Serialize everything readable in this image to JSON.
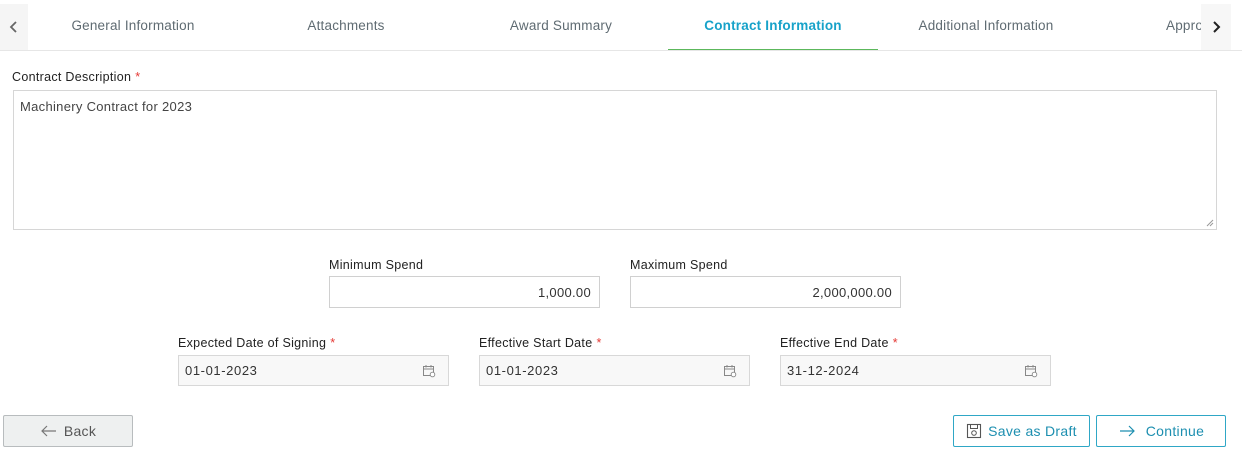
{
  "tabs": [
    {
      "label": "General Information",
      "active": false
    },
    {
      "label": "Attachments",
      "active": false
    },
    {
      "label": "Award Summary",
      "active": false
    },
    {
      "label": "Contract Information",
      "active": true
    },
    {
      "label": "Additional Information",
      "active": false
    },
    {
      "label": "Appro",
      "active": false
    }
  ],
  "icons": {
    "prev": "chevron-left-icon",
    "next": "chevron-right-icon",
    "calendar": "calendar-icon",
    "back": "arrow-left-icon",
    "draft": "save-draft-icon",
    "continue": "arrow-right-icon"
  },
  "colors": {
    "accent": "#17a2c9",
    "tab_underline": "#5cb85c",
    "required": "#e53935",
    "button_border": "#2fa7c6"
  },
  "form": {
    "contract_description": {
      "label": "Contract Description",
      "required": "*",
      "value": "Machinery Contract for 2023"
    },
    "minimum_spend": {
      "label": "Minimum Spend",
      "value": "1,000.00"
    },
    "maximum_spend": {
      "label": "Maximum Spend",
      "value": "2,000,000.00"
    },
    "expected_signing": {
      "label": "Expected Date of Signing",
      "required": "*",
      "value": "01-01-2023"
    },
    "effective_start": {
      "label": "Effective Start Date",
      "required": "*",
      "value": "01-01-2023"
    },
    "effective_end": {
      "label": "Effective End Date",
      "required": "*",
      "value": "31-12-2024"
    }
  },
  "buttons": {
    "back": "Back",
    "save_draft": "Save as Draft",
    "continue": "Continue"
  }
}
